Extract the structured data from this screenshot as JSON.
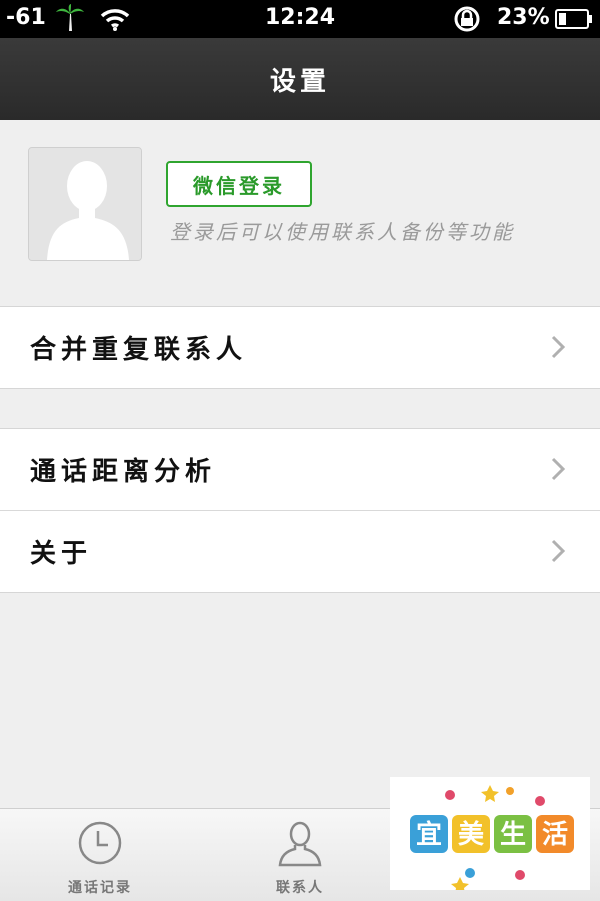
{
  "status": {
    "signal": "-61",
    "time": "12:24",
    "battery": "23%"
  },
  "nav": {
    "title": "设置"
  },
  "profile": {
    "login_button": "微信登录",
    "hint": "登录后可以使用联系人备份等功能"
  },
  "groups": [
    {
      "rows": [
        {
          "label": "合并重复联系人"
        }
      ]
    },
    {
      "rows": [
        {
          "label": "通话距离分析"
        },
        {
          "label": "关于"
        }
      ]
    }
  ],
  "tabbar": {
    "tabs": [
      {
        "label": "通话记录",
        "icon": "clock-icon"
      },
      {
        "label": "联系人",
        "icon": "person-icon"
      }
    ]
  },
  "watermark": {
    "text": "宜美生活"
  },
  "colors": {
    "accent_green": "#2fa52f",
    "nav_bg": "#2f2f2f",
    "page_bg": "#efefef"
  }
}
